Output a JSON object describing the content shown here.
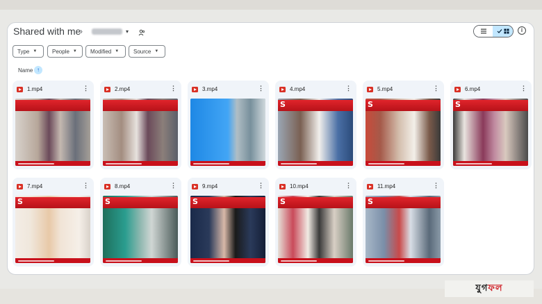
{
  "header": {
    "title": "Shared with me",
    "separator": "›",
    "user_caret": "▾"
  },
  "toolbar": {
    "info_label": "i"
  },
  "filters": [
    {
      "label": "Type"
    },
    {
      "label": "People"
    },
    {
      "label": "Modified"
    },
    {
      "label": "Source"
    }
  ],
  "sort": {
    "label": "Name",
    "direction_glyph": "↑"
  },
  "files": [
    {
      "name": "1.mp4"
    },
    {
      "name": "2.mp4"
    },
    {
      "name": "3.mp4"
    },
    {
      "name": "4.mp4"
    },
    {
      "name": "5.mp4"
    },
    {
      "name": "6.mp4"
    },
    {
      "name": "7.mp4"
    },
    {
      "name": "8.mp4"
    },
    {
      "name": "9.mp4"
    },
    {
      "name": "10.mp4"
    },
    {
      "name": "11.mp4"
    }
  ],
  "watermark": {
    "text_dark": "যুগ",
    "text_accent": "ফল"
  },
  "colors": {
    "accent_blue": "#c2e7ff",
    "video_icon_red": "#d93025",
    "news_red": "#e0242b",
    "tile_bg": "#f0f4f9"
  }
}
